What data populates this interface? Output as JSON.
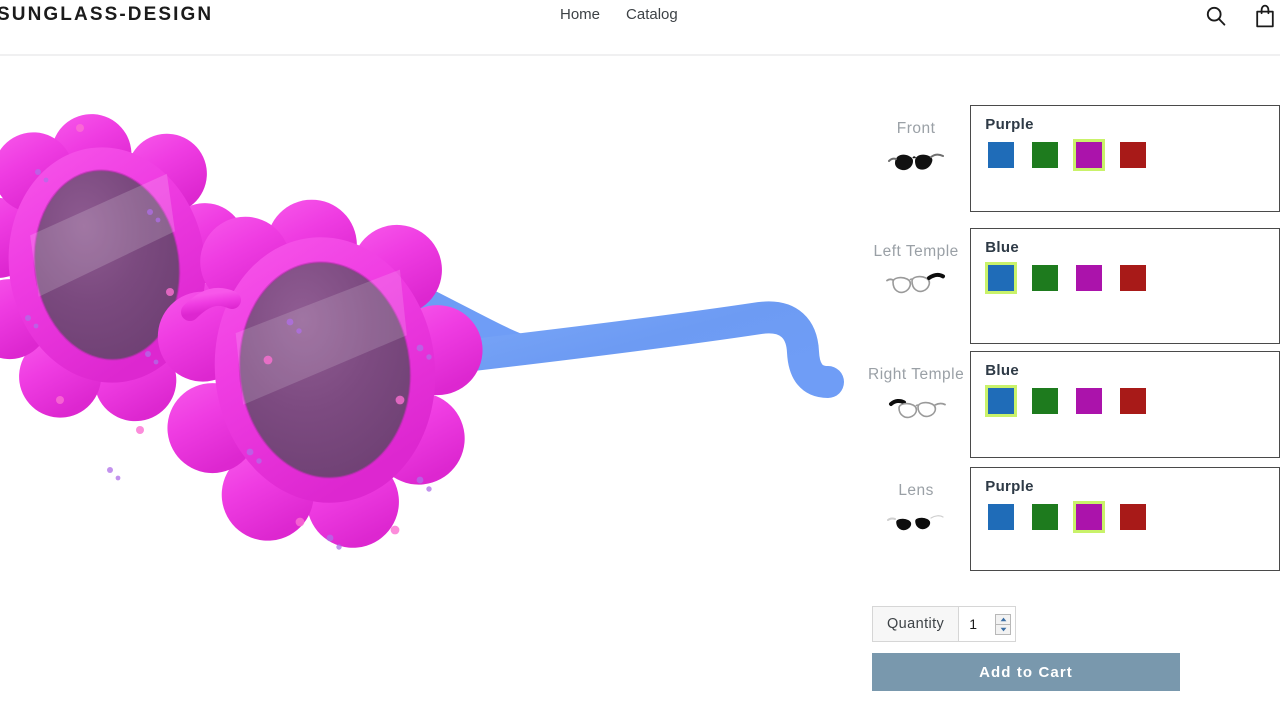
{
  "header": {
    "logo": "SUNGLASS-DESIGN",
    "nav": [
      {
        "label": "Home",
        "name": "nav-link-home"
      },
      {
        "label": "Catalog",
        "name": "nav-link-catalog"
      }
    ],
    "search_icon": "search-icon",
    "cart_icon": "shopping-bag-icon"
  },
  "product": {
    "name": "flower-shaped-kids-sunglasses",
    "frame_color": "#ec3ae0",
    "frame_color_dark": "#c91fc0",
    "lens_color": "#7e4a82",
    "temple_color": "#6f9cf5"
  },
  "palette": {
    "blue": "#1f6cb8",
    "green": "#1e7b1e",
    "purple": "#ab13ab",
    "red": "#a81a18",
    "selected_ring": "#c9f26a",
    "button": "#7998ad",
    "box_border": "#4a4a4a",
    "label_text": "#9aa0a6"
  },
  "options": [
    {
      "name": "front",
      "label": "Front",
      "icon": "glasses-front-icon",
      "selected_value": "Purple",
      "selected_index": 2,
      "swatches": [
        {
          "label": "Blue",
          "color": "#1f6cb8"
        },
        {
          "label": "Green",
          "color": "#1e7b1e"
        },
        {
          "label": "Purple",
          "color": "#ab13ab"
        },
        {
          "label": "Red",
          "color": "#a81a18"
        }
      ]
    },
    {
      "name": "left-temple",
      "label": "Left Temple",
      "icon": "glasses-left-temple-icon",
      "selected_value": "Blue",
      "selected_index": 0,
      "swatches": [
        {
          "label": "Blue",
          "color": "#1f6cb8"
        },
        {
          "label": "Green",
          "color": "#1e7b1e"
        },
        {
          "label": "Purple",
          "color": "#ab13ab"
        },
        {
          "label": "Red",
          "color": "#a81a18"
        }
      ]
    },
    {
      "name": "right-temple",
      "label": "Right Temple",
      "icon": "glasses-right-temple-icon",
      "selected_value": "Blue",
      "selected_index": 0,
      "swatches": [
        {
          "label": "Blue",
          "color": "#1f6cb8"
        },
        {
          "label": "Green",
          "color": "#1e7b1e"
        },
        {
          "label": "Purple",
          "color": "#ab13ab"
        },
        {
          "label": "Red",
          "color": "#a81a18"
        }
      ]
    },
    {
      "name": "lens",
      "label": "Lens",
      "icon": "glasses-lens-icon",
      "selected_value": "Purple",
      "selected_index": 2,
      "swatches": [
        {
          "label": "Blue",
          "color": "#1f6cb8"
        },
        {
          "label": "Green",
          "color": "#1e7b1e"
        },
        {
          "label": "Purple",
          "color": "#ab13ab"
        },
        {
          "label": "Red",
          "color": "#a81a18"
        }
      ]
    }
  ],
  "quantity": {
    "label": "Quantity",
    "value": "1",
    "placeholder": "1"
  },
  "add_to_cart": {
    "label": "Add to Cart"
  }
}
